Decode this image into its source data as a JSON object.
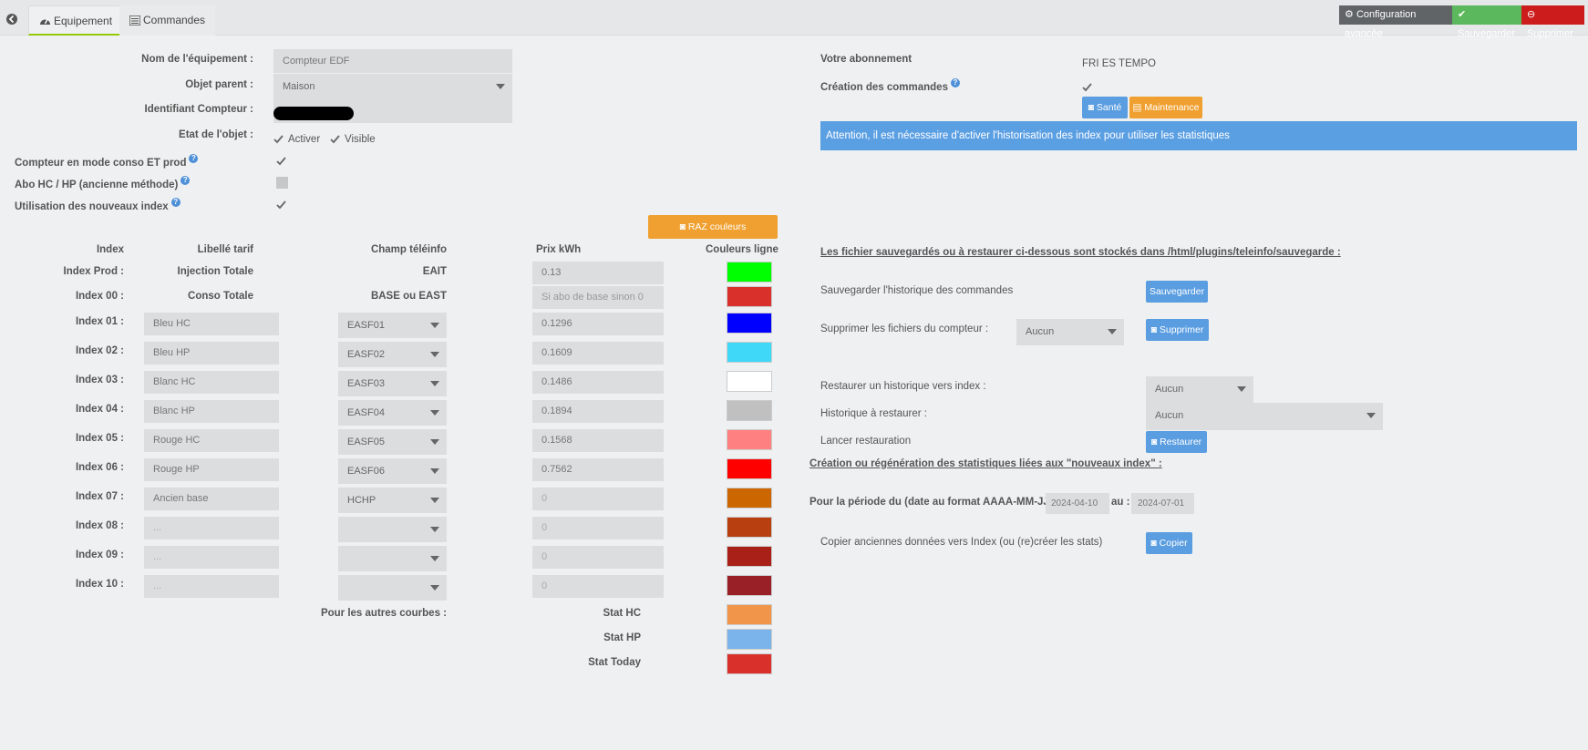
{
  "tabs": {
    "equipement": "Equipement",
    "commandes": "Commandes"
  },
  "toolbar": {
    "config": "Configuration avancée",
    "save": "Sauvegarder",
    "delete": "Supprimer"
  },
  "left": {
    "nom_label": "Nom de l'équipement :",
    "nom_value": "Compteur EDF",
    "objet_label": "Objet parent :",
    "objet_value": "Maison",
    "identifiant_label": "Identifiant Compteur :",
    "etat_label": "Etat de l'objet :",
    "activer": "Activer",
    "visible": "Visible",
    "conso_prod_label": "Compteur en mode conso ET prod",
    "abo_label": "Abo HC / HP (ancienne méthode)",
    "nouveaux_label": "Utilisation des nouveaux index",
    "raz_button": "RAZ couleurs"
  },
  "table": {
    "headers": {
      "index": "Index",
      "libelle": "Libellé tarif",
      "champ": "Champ téléinfo",
      "prix": "Prix kWh",
      "couleurs": "Couleurs ligne"
    },
    "prod_row": {
      "index": "Index Prod :",
      "libelle": "Injection Totale",
      "champ": "EAIT",
      "prix": "0.13",
      "color": "#00ff00"
    },
    "base_row": {
      "index": "Index 00 :",
      "libelle": "Conso Totale",
      "champ": "BASE ou EAST",
      "prix_placeholder": "Si abo de base sinon 0",
      "color": "#d9302c"
    },
    "rows": [
      {
        "index": "Index 01 :",
        "libelle": "Bleu HC",
        "champ": "EASF01",
        "prix": "0.1296",
        "color": "#0000ff"
      },
      {
        "index": "Index 02 :",
        "libelle": "Bleu HP",
        "champ": "EASF02",
        "prix": "0.1609",
        "color": "#40d8f8"
      },
      {
        "index": "Index 03 :",
        "libelle": "Blanc HC",
        "champ": "EASF03",
        "prix": "0.1486",
        "color": "#ffffff"
      },
      {
        "index": "Index 04 :",
        "libelle": "Blanc HP",
        "champ": "EASF04",
        "prix": "0.1894",
        "color": "#c0c0c0"
      },
      {
        "index": "Index 05 :",
        "libelle": "Rouge HC",
        "champ": "EASF05",
        "prix": "0.1568",
        "color": "#ff8080"
      },
      {
        "index": "Index 06 :",
        "libelle": "Rouge HP",
        "champ": "EASF06",
        "prix": "0.7562",
        "color": "#ff0000"
      },
      {
        "index": "Index 07 :",
        "libelle": "Ancien base",
        "champ": "HCHP",
        "prix": "0",
        "color": "#cc6600"
      },
      {
        "index": "Index 08 :",
        "libelle": "...",
        "champ": "",
        "prix": "0",
        "color": "#b84010"
      },
      {
        "index": "Index 09 :",
        "libelle": "...",
        "champ": "",
        "prix": "0",
        "color": "#a82018"
      },
      {
        "index": "Index 10 :",
        "libelle": "...",
        "champ": "",
        "prix": "0",
        "color": "#9a2028"
      }
    ],
    "autres_label": "Pour les autres courbes :",
    "stats": [
      {
        "label": "Stat HC",
        "color": "#f0954a"
      },
      {
        "label": "Stat HP",
        "color": "#7ab4ea"
      },
      {
        "label": "Stat Today",
        "color": "#d9302c"
      }
    ]
  },
  "right": {
    "abonnement_label": "Votre abonnement",
    "abonnement_value": "FRI ES TEMPO",
    "creation_label": "Création des commandes",
    "sante_button": "Santé",
    "maintenance_button": "Maintenance",
    "alert": "Attention, il est nécessaire d'activer l'historisation des index pour utiliser les statistiques",
    "fichiers_title": "Les fichier sauvegardés ou à restaurer ci-dessous sont stockés dans /html/plugins/teleinfo/sauvegarde :",
    "sauvegarder_label": "Sauvegarder l'historique des commandes",
    "sauvegarder_button": "Sauvegarder",
    "supprimer_label": "Supprimer les fichiers du compteur :",
    "supprimer_select": "Aucun",
    "supprimer_button": "Supprimer",
    "restaurer_label": "Restaurer un historique vers index :",
    "restaurer_select": "Aucun",
    "historique_label": "Historique à restaurer :",
    "historique_select": "Aucun",
    "lancer_label": "Lancer restauration",
    "restaurer_button": "Restaurer",
    "stats_title": "Création ou régénération des statistiques liées aux \"nouveaux index\" :",
    "periode_label": "Pour la période du (date au format AAAA-MM-JJ) :",
    "date_from": "2024-04-10",
    "au_label": "au :",
    "date_to": "2024-07-01",
    "copier_label": "Copier anciennes données vers Index (ou (re)créer les stats)",
    "copier_button": "Copier"
  }
}
